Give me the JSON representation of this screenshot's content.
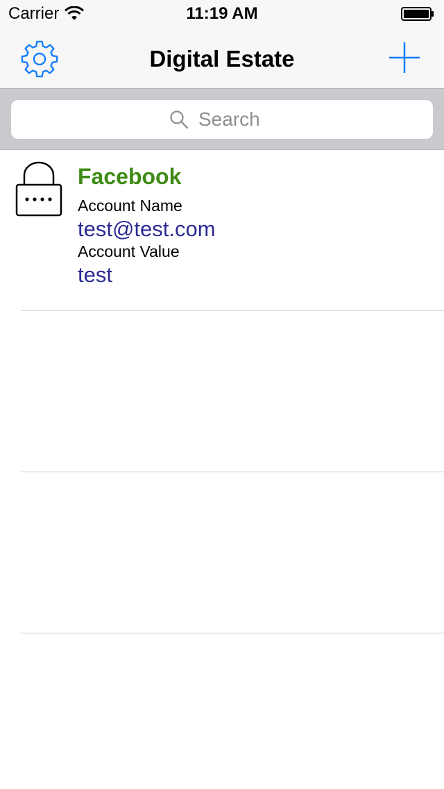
{
  "status_bar": {
    "carrier": "Carrier",
    "time": "11:19 AM",
    "wifi_icon": "wifi-icon",
    "battery_icon": "battery-icon"
  },
  "nav_bar": {
    "title": "Digital Estate",
    "left_icon": "gear-icon",
    "right_icon": "plus-icon",
    "tint_color": "#157efb"
  },
  "search": {
    "placeholder": "Search",
    "value": ""
  },
  "list": {
    "items": [
      {
        "icon": "lock-icon",
        "title": "Facebook",
        "name_label": "Account Name",
        "name_value": "test@test.com",
        "value_label": "Account Value",
        "value_value": "test"
      }
    ]
  },
  "colors": {
    "title_green": "#3f8b16",
    "value_blue": "#2b2b93",
    "search_bar_bg": "#c9c9ce",
    "separator": "#c8c7cc"
  }
}
